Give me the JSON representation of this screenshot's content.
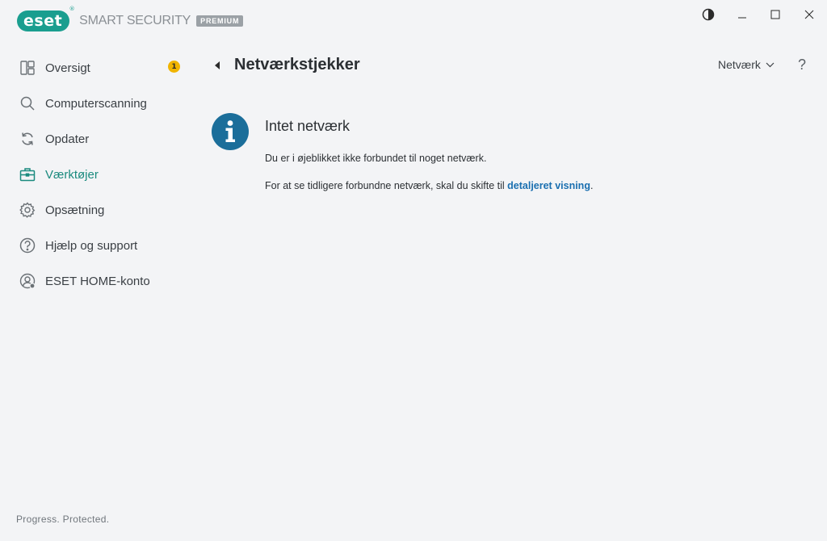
{
  "app": {
    "brand": "eset",
    "product_name": "SMART SECURITY",
    "edition": "PREMIUM",
    "accent_color": "#1a9e8f"
  },
  "window_controls": {
    "theme_icon": "contrast-icon",
    "minimize_icon": "minimize-icon",
    "maximize_icon": "maximize-icon",
    "close_icon": "close-icon"
  },
  "sidebar": {
    "items": [
      {
        "label": "Oversigt",
        "icon": "dashboard-icon",
        "badge": "1"
      },
      {
        "label": "Computerscanning",
        "icon": "search-icon"
      },
      {
        "label": "Opdater",
        "icon": "refresh-icon"
      },
      {
        "label": "Værktøjer",
        "icon": "toolbox-icon",
        "active": true
      },
      {
        "label": "Opsætning",
        "icon": "gear-icon"
      },
      {
        "label": "Hjælp og support",
        "icon": "help-icon"
      },
      {
        "label": "ESET HOME-konto",
        "icon": "account-icon"
      }
    ],
    "footer": "Progress. Protected."
  },
  "main": {
    "title": "Netværkstjekker",
    "network_dropdown": "Netværk",
    "help": "?",
    "info": {
      "title": "Intet netværk",
      "line1": "Du er i øjeblikket ikke forbundet til noget netværk.",
      "line2_prefix": "For at se tidligere forbundne netværk, skal du skifte til ",
      "line2_link": "detaljeret visning",
      "line2_suffix": "."
    }
  }
}
